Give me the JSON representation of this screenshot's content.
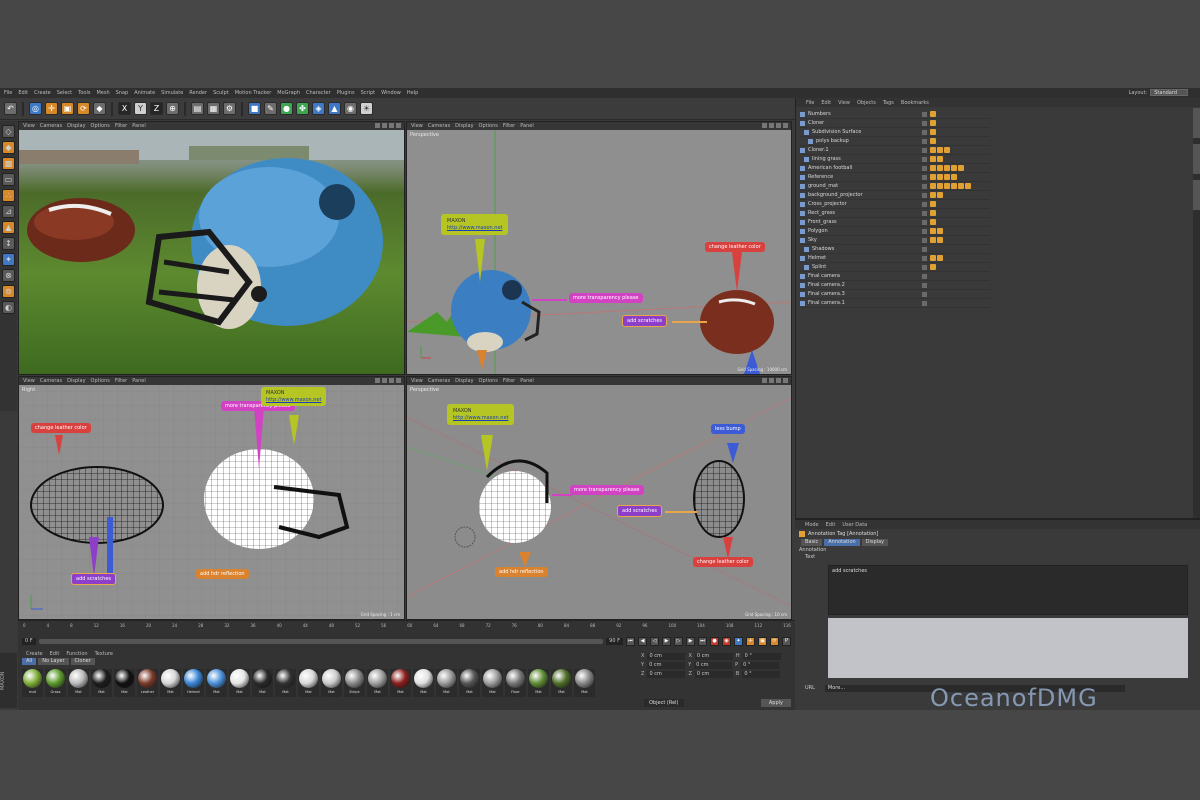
{
  "menubar": {
    "items": [
      "File",
      "Edit",
      "Create",
      "Select",
      "Tools",
      "Mesh",
      "Snap",
      "Animate",
      "Simulate",
      "Render",
      "Sculpt",
      "Motion Tracker",
      "MoGraph",
      "Character",
      "Plugins",
      "Script",
      "Window",
      "Help"
    ],
    "layout_label": "Layout:",
    "layout_value": "Standard"
  },
  "toolbar": {
    "icons": [
      "undo-icon",
      "move-icon",
      "scale-icon",
      "rotate-icon",
      "x-axis-icon",
      "y-axis-icon",
      "z-axis-icon",
      "world-icon",
      "render-view-icon",
      "render-picture-icon",
      "render-settings-icon",
      "cube-icon",
      "pen-icon",
      "subdivision-icon",
      "array-icon",
      "deformer-icon",
      "scene-icon",
      "camera-icon",
      "light-icon"
    ]
  },
  "viewports": {
    "v1": {
      "menu": [
        "View",
        "Cameras",
        "Display",
        "Options",
        "Filter",
        "Panel"
      ],
      "name": "Render"
    },
    "v2": {
      "menu": [
        "View",
        "Cameras",
        "Display",
        "Options",
        "Filter",
        "Panel"
      ],
      "name": "Perspective",
      "spacing": "Grid Spacing : 10000 cm"
    },
    "v3": {
      "menu": [
        "View",
        "Cameras",
        "Display",
        "Options",
        "Filter",
        "Panel"
      ],
      "name": "Right",
      "spacing": "Grid Spacing : 1 cm"
    },
    "v4": {
      "menu": [
        "View",
        "Cameras",
        "Display",
        "Options",
        "Filter",
        "Panel"
      ],
      "name": "Perspective",
      "spacing": "Grid Spacing : 10 cm"
    }
  },
  "annotations": {
    "maxon_title": "MAXON",
    "maxon_url": "http://www.maxon.net",
    "transparency": "more transparency please",
    "change_leather": "change leather color",
    "add_scratches": "add scratches",
    "add_reflection": "add hdr reflection",
    "bump": "less bump"
  },
  "object_manager": {
    "menu": [
      "File",
      "Edit",
      "View",
      "Objects",
      "Tags",
      "Bookmarks"
    ],
    "objects": [
      "Numbers",
      "Cloner",
      "Subdivision Surface",
      "polys backup",
      "Cloner.1",
      "lining grass",
      "American football",
      "Reference",
      "ground_mat",
      "background_projector",
      "Cross_projector",
      "Rect_grass",
      "Front_grass",
      "Polygon",
      "Sky",
      "Shadows",
      "Helmet",
      "Splint",
      "Final camera",
      "Final camera.2",
      "Final camera.3",
      "Final camera.1"
    ]
  },
  "attributes": {
    "menu": [
      "Mode",
      "Edit",
      "User Data"
    ],
    "title": "Annotation Tag [Annotation]",
    "tabs": [
      "Basic",
      "Annotation",
      "Display"
    ],
    "section": "Annotation",
    "text_label": "Text",
    "text_value": "add scratches",
    "url_label": "URL",
    "url_value": "More..."
  },
  "timeline": {
    "ticks": [
      "0",
      "4",
      "8",
      "12",
      "16",
      "20",
      "24",
      "28",
      "32",
      "36",
      "40",
      "44",
      "48",
      "52",
      "56",
      "60",
      "64",
      "68",
      "72",
      "76",
      "80",
      "84",
      "88",
      "92",
      "96",
      "100",
      "104",
      "108",
      "112",
      "116"
    ],
    "start": "0 F",
    "end": "90 F",
    "current": "90 F"
  },
  "materials": {
    "menu": [
      "Create",
      "Edit",
      "Function",
      "Texture"
    ],
    "tabs": [
      "All",
      "No Layer",
      "Cloner"
    ],
    "items": [
      {
        "name": "mat",
        "color": "#7fae3a"
      },
      {
        "name": "Grass",
        "color": "#5c9a2c"
      },
      {
        "name": "Mat",
        "color": "#bcbcbc"
      },
      {
        "name": "Mat",
        "color": "#1c1c1c"
      },
      {
        "name": "Mat",
        "color": "#111111"
      },
      {
        "name": "Leather",
        "color": "#7a3a2a"
      },
      {
        "name": "Mat",
        "color": "#d7d7d7"
      },
      {
        "name": "Helmet",
        "color": "#3b86d6"
      },
      {
        "name": "Mat",
        "color": "#4a90d9"
      },
      {
        "name": "Mat",
        "color": "#e6e6e6"
      },
      {
        "name": "Mat",
        "color": "#2a2a2a"
      },
      {
        "name": "Mat",
        "color": "#333333"
      },
      {
        "name": "Mat",
        "color": "#d9d9d9"
      },
      {
        "name": "Mat",
        "color": "#cccccc"
      },
      {
        "name": "Stripe",
        "color": "#8a8a8a"
      },
      {
        "name": "Mat",
        "color": "#a0a0a0"
      },
      {
        "name": "Mat",
        "color": "#8b1e1e"
      },
      {
        "name": "Mat",
        "color": "#e0e0e0"
      },
      {
        "name": "Mat",
        "color": "#9a9a9a"
      },
      {
        "name": "Mat",
        "color": "#555555"
      },
      {
        "name": "Mat",
        "color": "#9c9c9c"
      },
      {
        "name": "Floor",
        "color": "#777777"
      },
      {
        "name": "Mat",
        "color": "#5f8c36"
      },
      {
        "name": "Mat",
        "color": "#4f6f2a"
      },
      {
        "name": "Mat",
        "color": "#888888"
      }
    ]
  },
  "coordinates": {
    "rows": [
      {
        "a": "X",
        "av": "0 cm",
        "b": "X",
        "bv": "0 cm",
        "c": "H",
        "cv": "0 °"
      },
      {
        "a": "Y",
        "av": "0 cm",
        "b": "Y",
        "bv": "0 cm",
        "c": "P",
        "cv": "0 °"
      },
      {
        "a": "Z",
        "av": "0 cm",
        "b": "Z",
        "bv": "0 cm",
        "c": "B",
        "cv": "0 °"
      }
    ],
    "mode": "Object (Rel)",
    "size": "Size",
    "apply": "Apply"
  },
  "sidebar_label": "MAXON",
  "watermark": "OceanofDMG"
}
